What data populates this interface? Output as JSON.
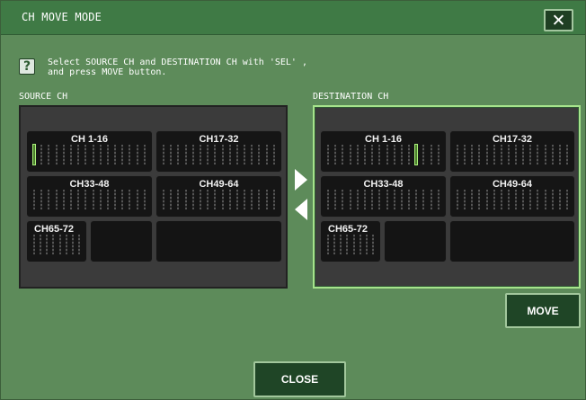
{
  "window": {
    "title": "CH MOVE MODE",
    "close_icon": "close-icon"
  },
  "help": {
    "icon": "?",
    "line1": "Select SOURCE CH and DESTINATION CH with 'SEL' ,",
    "line2": "and press MOVE button."
  },
  "source": {
    "label": "SOURCE CH",
    "groups": [
      "CH 1-16",
      "CH17-32",
      "CH33-48",
      "CH49-64",
      "CH65-72"
    ]
  },
  "destination": {
    "label": "DESTINATION CH",
    "groups": [
      "CH 1-16",
      "CH17-32",
      "CH33-48",
      "CH49-64",
      "CH65-72"
    ]
  },
  "buttons": {
    "move": "MOVE",
    "close": "CLOSE"
  },
  "colors": {
    "window_bg": "#5d8b5a",
    "titlebar": "#3f7a45",
    "panel_bg": "#3b3b3b",
    "dest_border": "#a6e38c",
    "selected_fader": "#a9f07a"
  }
}
